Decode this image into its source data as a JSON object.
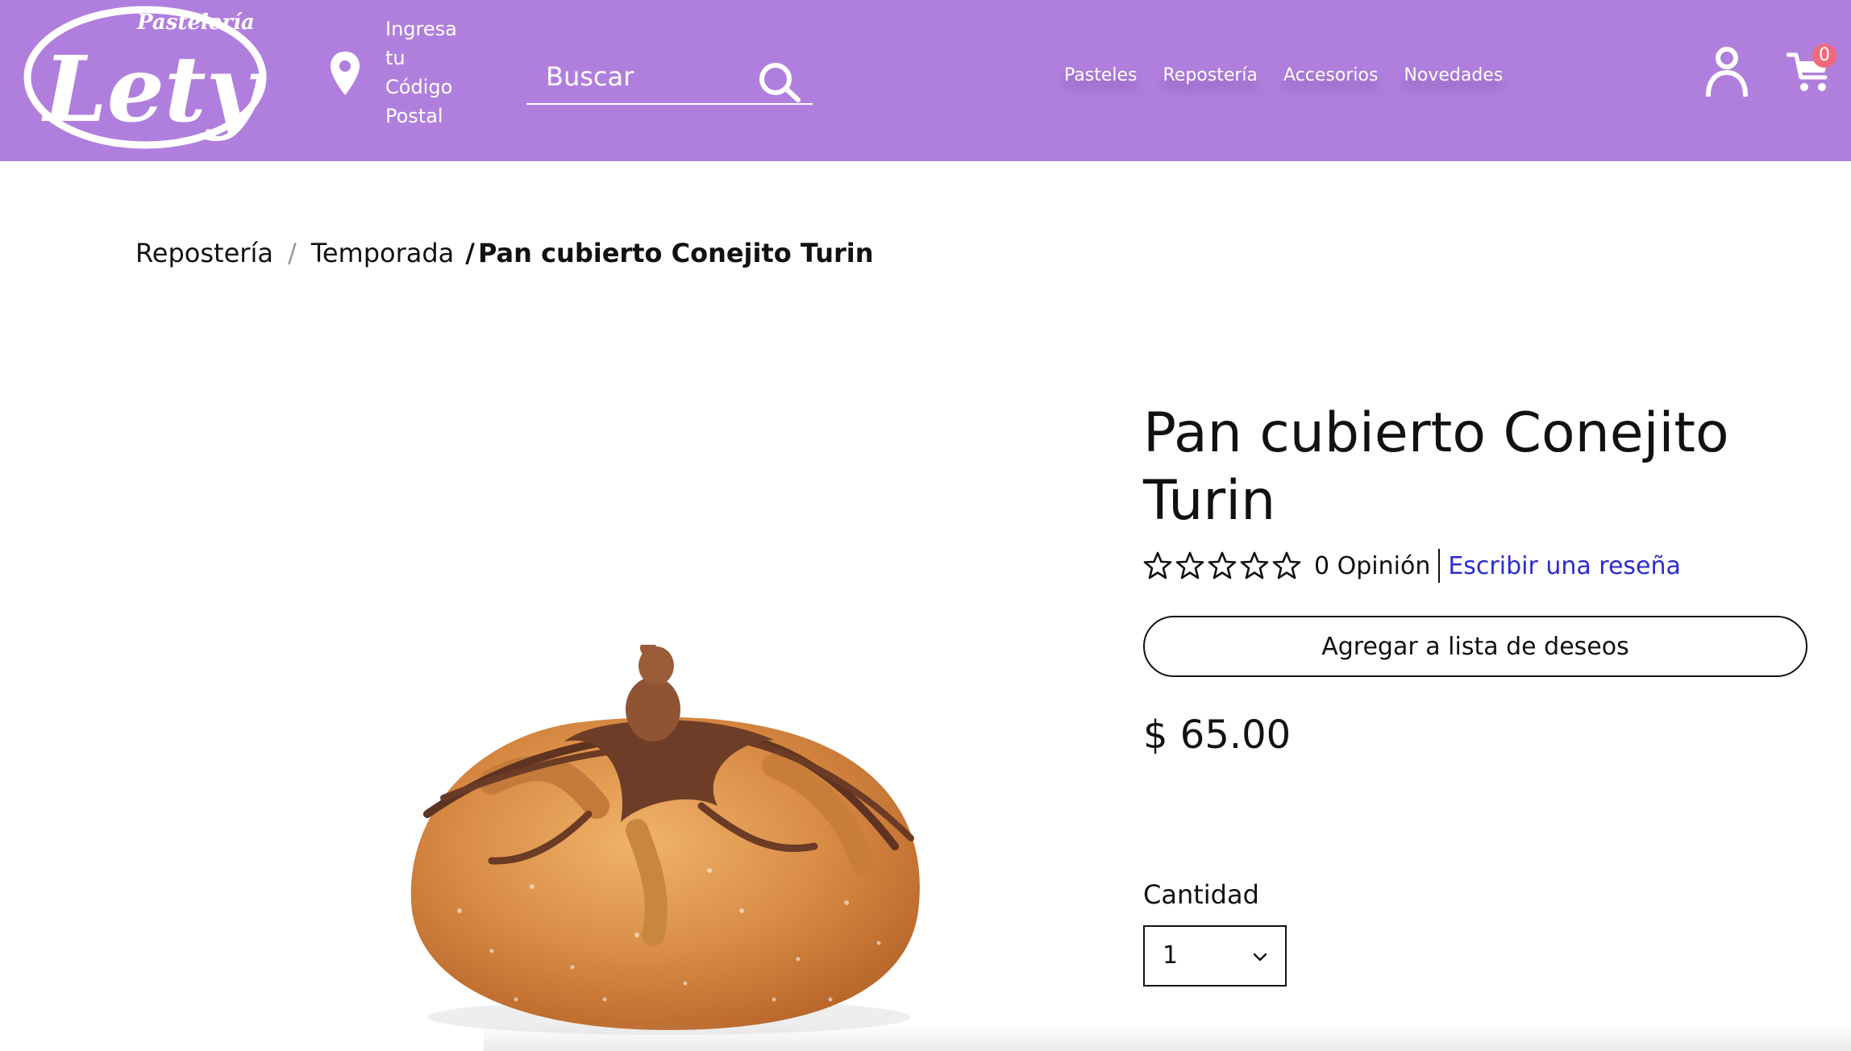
{
  "header": {
    "logo_top_text": "Pastelería",
    "logo_main_text": "Lety",
    "postal_lines": [
      "Ingresa",
      "tu",
      "Código",
      "Postal"
    ],
    "search_placeholder": "Buscar",
    "nav": [
      "Pasteles",
      "Repostería",
      "Accesorios",
      "Novedades"
    ],
    "cart_count": "0",
    "icons": [
      "location-pin-icon",
      "search-icon",
      "user-icon",
      "cart-icon"
    ]
  },
  "breadcrumb": {
    "items": [
      "Repostería",
      "Temporada"
    ],
    "separator": "/",
    "current": "Pan cubierto Conejito Turin"
  },
  "product": {
    "title": "Pan cubierto Conejito Turin",
    "rating": 0,
    "rating_max": 5,
    "opinions": "0 Opinión",
    "review_link": "Escribir una reseña",
    "wishlist_label": "Agregar a lista de deseos",
    "price": "$ 65.00",
    "quantity_label": "Cantidad",
    "quantity_value": "1"
  },
  "colors": {
    "header_bg": "#b07fde",
    "link": "#2c2cd1",
    "badge": "#f2697c"
  }
}
